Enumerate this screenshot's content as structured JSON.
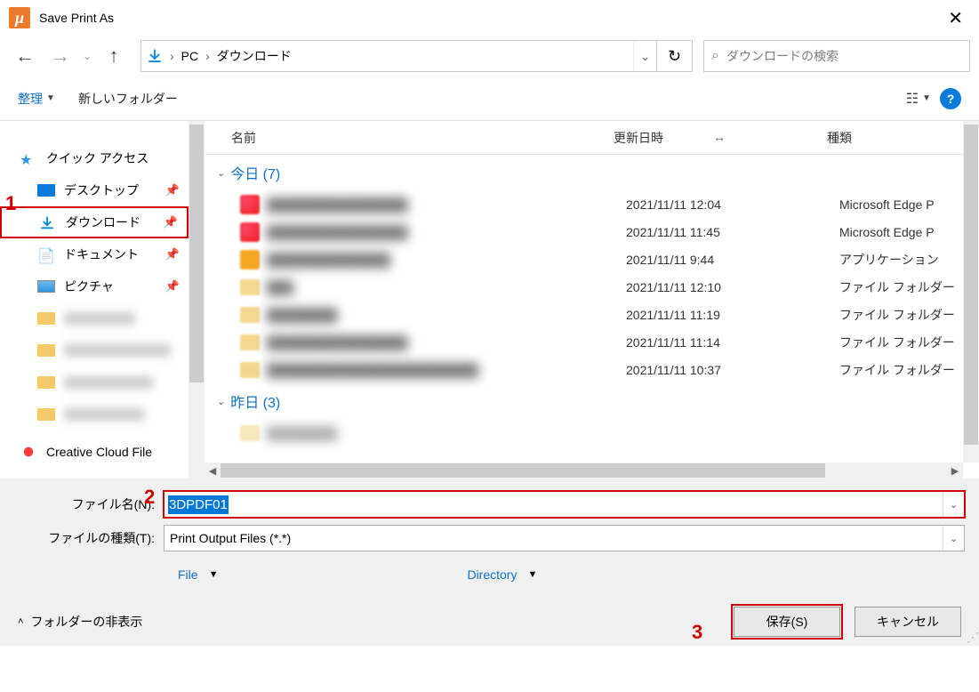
{
  "titlebar": {
    "title": "Save Print As"
  },
  "breadcrumb": {
    "root": "PC",
    "current": "ダウンロード"
  },
  "search": {
    "placeholder": "ダウンロードの検索"
  },
  "toolbar": {
    "organize": "整理",
    "newfolder": "新しいフォルダー"
  },
  "columns": {
    "name": "名前",
    "date": "更新日時",
    "type": "種類"
  },
  "sidebar": {
    "quick": "クイック アクセス",
    "desktop": "デスクトップ",
    "downloads": "ダウンロード",
    "documents": "ドキュメント",
    "pictures": "ピクチャ",
    "ccloud": "Creative Cloud File"
  },
  "groups": {
    "today": "今日 (7)",
    "yesterday": "昨日 (3)"
  },
  "rows": [
    {
      "date": "2021/11/11 12:04",
      "type": "Microsoft Edge P"
    },
    {
      "date": "2021/11/11 11:45",
      "type": "Microsoft Edge P"
    },
    {
      "date": "2021/11/11 9:44",
      "type": "アプリケーション"
    },
    {
      "date": "2021/11/11 12:10",
      "type": "ファイル フォルダー"
    },
    {
      "date": "2021/11/11 11:19",
      "type": "ファイル フォルダー"
    },
    {
      "date": "2021/11/11 11:14",
      "type": "ファイル フォルダー"
    },
    {
      "date": "2021/11/11 10:37",
      "type": "ファイル フォルダー"
    }
  ],
  "form": {
    "filename_label": "ファイル名(N):",
    "filename_value": "3DPDF01",
    "filetype_label": "ファイルの種類(T):",
    "filetype_value": "Print Output Files (*.*)",
    "file_dd": "File",
    "dir_dd": "Directory"
  },
  "actions": {
    "hide_folders": "フォルダーの非表示",
    "save": "保存(S)",
    "cancel": "キャンセル"
  },
  "annotations": {
    "a1": "1",
    "a2": "2",
    "a3": "3"
  }
}
